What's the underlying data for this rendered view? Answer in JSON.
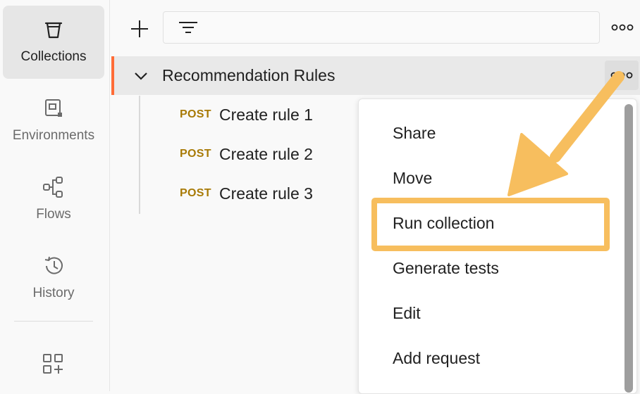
{
  "sidebar": {
    "items": [
      {
        "label": "Collections",
        "icon": "trash-collection-icon",
        "active": true
      },
      {
        "label": "Environments",
        "icon": "environment-icon",
        "active": false
      },
      {
        "label": "Flows",
        "icon": "flows-icon",
        "active": false
      },
      {
        "label": "History",
        "icon": "history-icon",
        "active": false
      }
    ],
    "apps_icon": "apps-add-icon"
  },
  "toolbar": {
    "add_icon": "plus-icon",
    "filter_icon": "filter-icon",
    "more_icon": "more-horizontal-icon",
    "search_value": ""
  },
  "collection": {
    "name": "Recommendation Rules",
    "expanded": true,
    "requests": [
      {
        "method": "POST",
        "name": "Create rule 1"
      },
      {
        "method": "POST",
        "name": "Create rule 2"
      },
      {
        "method": "POST",
        "name": "Create rule 3"
      }
    ]
  },
  "context_menu": {
    "items": [
      "Share",
      "Move",
      "Run collection",
      "Generate tests",
      "Edit",
      "Add request"
    ],
    "highlighted": "Run collection"
  },
  "colors": {
    "accent": "#ff6c37",
    "method_post": "#a87a06",
    "highlight": "#f7be5e"
  }
}
